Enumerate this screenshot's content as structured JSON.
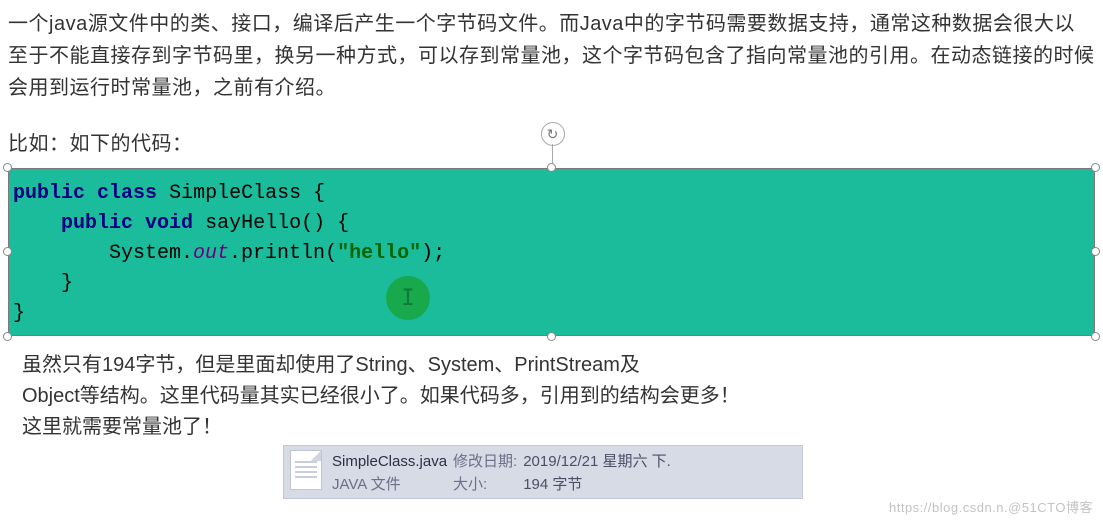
{
  "intro": {
    "p1": "一个java源文件中的类、接口，编译后产生一个字节码文件。而Java中的字节码需要数据支持，通常这种数据会很大以至于不能直接存到字节码里，换另一种方式，可以存到常量池，这个字节码包含了指向常量池的引用。在动态链接的时候会用到运行时常量池，之前有介绍。",
    "p2": "比如：如下的代码："
  },
  "code": {
    "kw_public1": "public",
    "kw_class": "class",
    "class_name": "SimpleClass",
    "brace_open": " {",
    "kw_public2": "public",
    "kw_void": "void",
    "method": "sayHello()",
    "brace_open2": " {",
    "sys": "System.",
    "out": "out",
    "println": ".println(",
    "str": "\"hello\"",
    "tail": ");",
    "brace_close_inner": "    }",
    "brace_close_outer": "}",
    "cursor_char": "I"
  },
  "after": {
    "line1": "虽然只有194字节，但是里面却使用了String、System、PrintStream及",
    "line2": "Object等结构。这里代码量其实已经很小了。如果代码多，引用到的结构会更多！",
    "line3": "这里就需要常量池了！"
  },
  "file": {
    "name": "SimpleClass.java",
    "mod_label": "修改日期:",
    "mod_value": "2019/12/21 星期六 下.",
    "type_label": "JAVA 文件",
    "size_label": "大小:",
    "size_value": "194 字节"
  },
  "watermark": "https://blog.csdn.n.@51CTO博客",
  "rotate_glyph": "↻"
}
